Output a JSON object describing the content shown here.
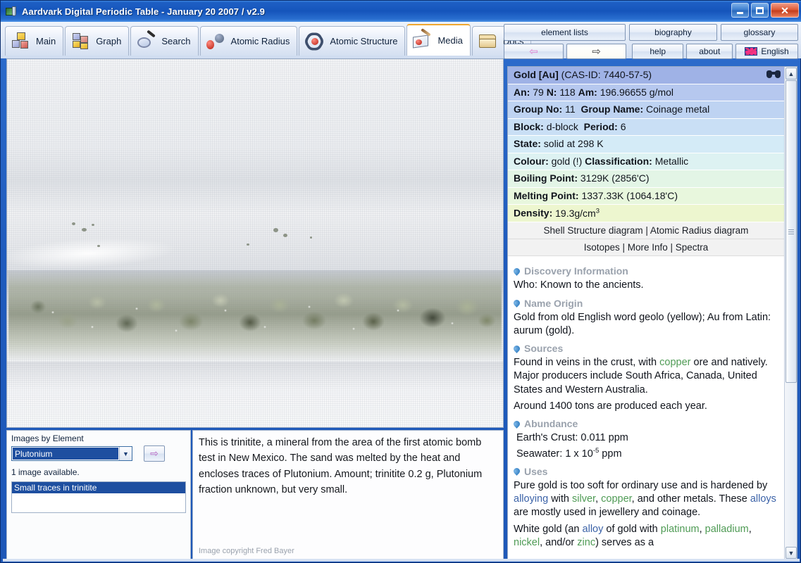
{
  "window": {
    "title": "Aardvark Digital Periodic Table - January 20 2007 / v2.9",
    "icon": "periodic-table-icon",
    "controls": {
      "minimize": "_",
      "maximize": "□",
      "close": "✕"
    }
  },
  "tabs": [
    {
      "label": "Main",
      "icon": "cubes-icon",
      "active": false
    },
    {
      "label": "Graph",
      "icon": "bar-cubes-icon",
      "active": false
    },
    {
      "label": "Search",
      "icon": "magnifier-icon",
      "active": false
    },
    {
      "label": "Atomic Radius",
      "icon": "two-spheres-icon",
      "active": false
    },
    {
      "label": "Atomic Structure",
      "icon": "atom-orbit-icon",
      "active": false
    },
    {
      "label": "Media",
      "icon": "paint-photo-icon",
      "active": true
    },
    {
      "label": "Docs",
      "icon": "folder-icon",
      "active": false
    }
  ],
  "toolbar": {
    "row1": [
      {
        "label": "element lists"
      },
      {
        "label": "biography"
      },
      {
        "label": "glossary"
      }
    ],
    "row2": [
      {
        "label": "",
        "icon": "arrow-left-icon",
        "glyph": "⇦"
      },
      {
        "label": "",
        "icon": "arrow-right-icon",
        "glyph": "⇨"
      },
      {
        "label": "help"
      },
      {
        "label": "about"
      },
      {
        "label": "English",
        "icon": "uk-flag-icon"
      }
    ]
  },
  "media": {
    "image_alt": "Small traces in trinitite - greenish granular mineral on white cloth",
    "selector_label": "Images by Element",
    "selected_element": "Plutonium",
    "dropdown_glyph": "▼",
    "go_glyph": "⇨",
    "availability": "1 image available.",
    "image_items": [
      "Small traces in trinitite"
    ],
    "caption": "This is trinitite, a mineral from the area of the first atomic bomb test in New Mexico. The sand was melted by the heat and encloses traces of Plutonium. Amount; trinitite 0.2 g, Plutonium fraction unknown, but very small.",
    "copyright": "Image copyright Fred Bayer"
  },
  "element": {
    "header": {
      "name_bracket": "Gold [Au]",
      "cas": "(CAS-ID: 7440-57-5)",
      "search_icon": "binoculars-icon"
    },
    "rows": [
      {
        "parts": [
          {
            "b": "An:",
            "v": "79"
          },
          {
            "b": "N:",
            "v": "118"
          },
          {
            "b": "Am:",
            "v": "196.96655 g/mol"
          }
        ]
      },
      {
        "parts": [
          {
            "b": "Group No:",
            "v": "11"
          },
          {
            "b": "Group Name:",
            "v": "Coinage metal"
          }
        ]
      },
      {
        "parts": [
          {
            "b": "Block:",
            "v": "d-block"
          },
          {
            "b": "Period:",
            "v": "6"
          }
        ]
      },
      {
        "parts": [
          {
            "b": "State:",
            "v": "solid at 298 K"
          }
        ]
      },
      {
        "parts": [
          {
            "b": "Colour:",
            "v": "gold (!)"
          },
          {
            "b": "Classification:",
            "v": "Metallic"
          }
        ]
      },
      {
        "parts": [
          {
            "b": "Boiling Point:",
            "v": "3129K (2856'C)"
          }
        ]
      },
      {
        "parts": [
          {
            "b": "Melting Point:",
            "v": "1337.33K (1064.18'C)"
          }
        ]
      },
      {
        "parts": [
          {
            "b": "Density:",
            "v": "19.3g/cm3"
          }
        ]
      }
    ],
    "links_row1": "Shell Structure diagram | Atomic Radius diagram",
    "links_row2": "Isotopes | More Info | Spectra",
    "sections": [
      {
        "title": "Discovery Information",
        "body": "Who: Known to the ancients."
      },
      {
        "title": "Name Origin",
        "body": "Gold from old English word geolo (yellow); Au from Latin: aurum (gold)."
      },
      {
        "title": "Sources",
        "body": "Found in veins in the crust, with copper ore and natively. Major producers include South Africa, Canada, United States and Western Australia.",
        "body2": "Around 1400 tons are produced each year."
      },
      {
        "title": "Abundance",
        "line1": "Earth's Crust: 0.011 ppm",
        "line2": "Seawater: 1 x 10-5 ppm"
      },
      {
        "title": "Uses",
        "body": "Pure gold is too soft for ordinary use and is hardened by alloying with silver, copper, and other metals. These alloys are mostly used in jewellery and coinage.",
        "body2": "White gold (an alloy of gold with platinum, palladium, nickel, and/or zinc) serves as a"
      }
    ]
  },
  "colors": {
    "title_blue": "#1e5fc4",
    "header_row": "#9fb2e6",
    "link_green": "#4f9b55",
    "link_blue": "#3c63a8",
    "accent_orange": "#f0a830",
    "select_blue": "#1e4fa0"
  }
}
